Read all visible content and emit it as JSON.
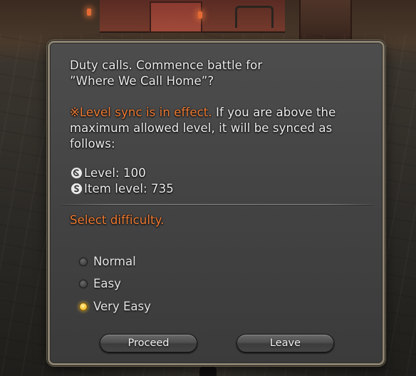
{
  "dialog": {
    "message_line1": "Duty calls. Commence battle for",
    "message_line2": "”Where We Call Home”?",
    "sync_notice": "※Level sync is in effect.",
    "sync_detail_line1": " If you are above the",
    "sync_detail_line2": "maximum allowed level, it will be synced as",
    "sync_detail_line3": "follows:",
    "level": "Level: 100",
    "item_level": "Item level: 735",
    "difficulty_prompt": "Select difficulty.",
    "difficulty_options": [
      {
        "label": "Normal",
        "selected": false
      },
      {
        "label": "Easy",
        "selected": false
      },
      {
        "label": "Very Easy",
        "selected": true
      }
    ],
    "proceed_label": "Proceed",
    "leave_label": "Leave"
  },
  "colors": {
    "warning": "#f07c35",
    "selected_radio": "#f5c437",
    "text": "#eeeeee"
  }
}
